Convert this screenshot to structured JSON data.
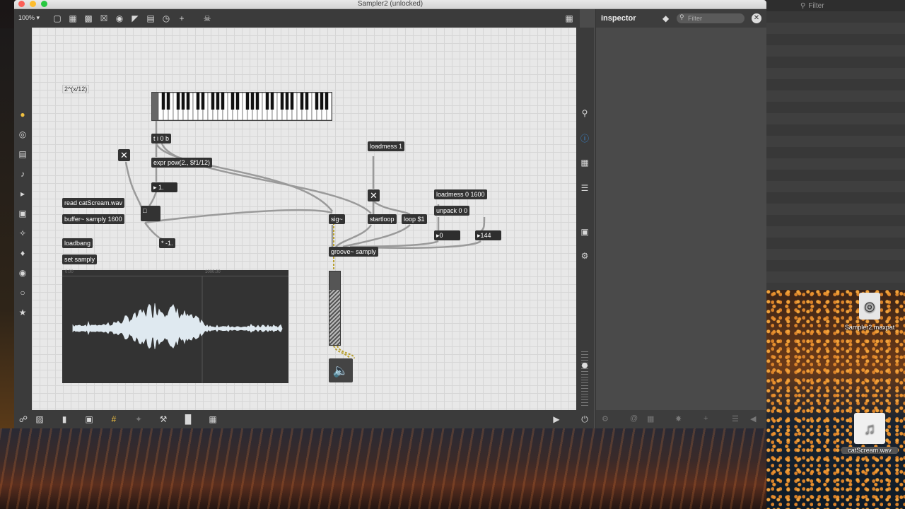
{
  "window": {
    "title": "Sampler2 (unlocked)",
    "zoom": "100%"
  },
  "inspector": {
    "title": "inspector",
    "filter_placeholder": "Filter"
  },
  "side_panel": {
    "filter_placeholder": "Filter"
  },
  "patch": {
    "comment": "2^(x/12)",
    "objects": {
      "trigger": "t i 0 b",
      "expr": "expr pow(2., $f1/12)",
      "float_box": "1.",
      "read_msg": "read catScream.wav",
      "buffer": "buffer~ samply 1600",
      "multiply": "* -1.",
      "loadbang": "loadbang",
      "set_msg": "set samply",
      "loadmess1": "loadmess 1",
      "sig": "sig~",
      "startloop": "startloop",
      "loop_msg": "loop $1",
      "loadmess2": "loadmess 0 1600",
      "unpack": "unpack 0 0",
      "num_zero": "0",
      "num_144": "144",
      "groove": "groove~ samply"
    },
    "waveform_rulers": [
      "0.00",
      "1000.00"
    ],
    "meter_level": 0.75
  },
  "desktop": {
    "icon1": "Sampler2.maxpat",
    "icon2": "catScream.wav"
  },
  "colors": {
    "canvas": "#e8e8e8",
    "object": "#333333",
    "panel": "#3b3b3b",
    "inspector_icon_blue": "#3a8dde"
  }
}
